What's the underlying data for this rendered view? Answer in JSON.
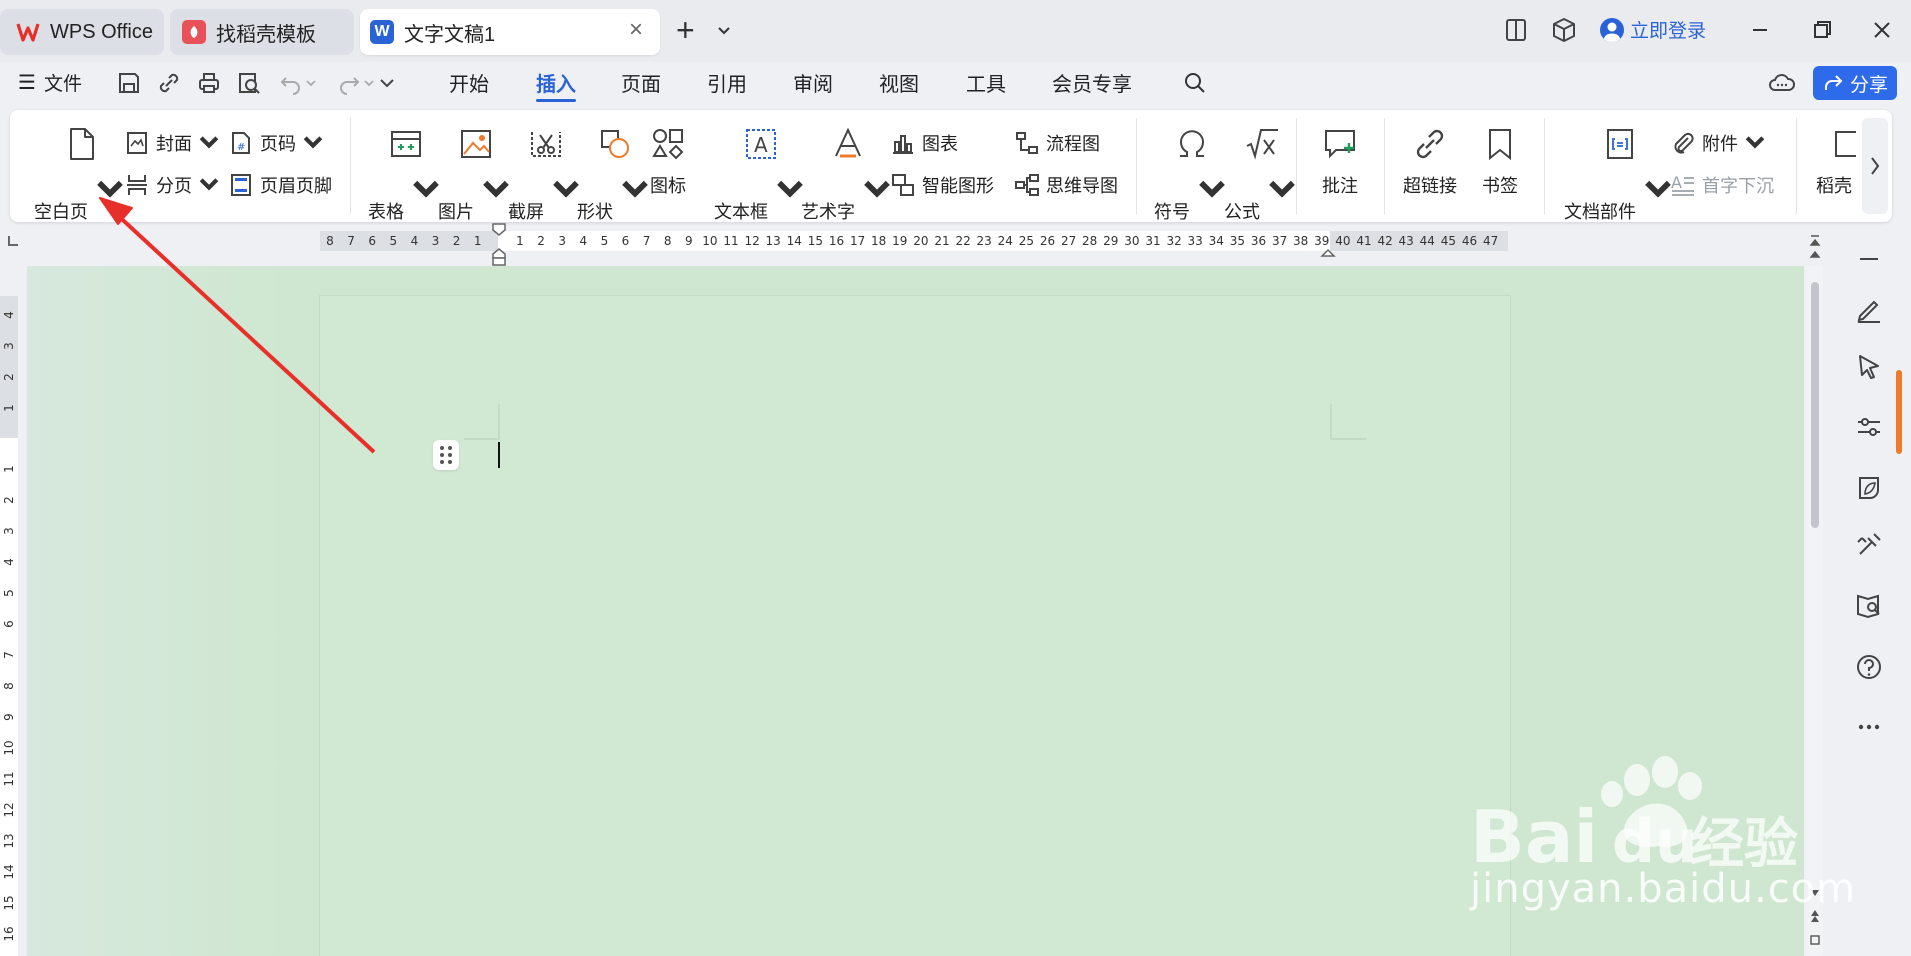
{
  "titlebar": {
    "tabs": [
      {
        "label": "WPS Office"
      },
      {
        "label": "找稻壳模板"
      },
      {
        "label": "文字文稿1"
      }
    ],
    "login_label": "立即登录"
  },
  "menubar": {
    "file_label": "文件",
    "tabs": [
      "开始",
      "插入",
      "页面",
      "引用",
      "审阅",
      "视图",
      "工具",
      "会员专享"
    ],
    "active_tab": "插入",
    "share_label": "分享"
  },
  "ribbon": {
    "blank_page": "空白页",
    "cover": "封面",
    "page_number": "页码",
    "page_break": "分页",
    "header_footer": "页眉页脚",
    "table": "表格",
    "picture": "图片",
    "screenshot": "截屏",
    "shape": "形状",
    "icon": "图标",
    "textbox": "文本框",
    "wordart": "艺术字",
    "chart": "图表",
    "smartart": "智能图形",
    "flowchart": "流程图",
    "mindmap": "思维导图",
    "symbol": "符号",
    "formula": "公式",
    "comment": "批注",
    "hyperlink": "超链接",
    "bookmark": "书签",
    "doc_parts": "文档部件",
    "attachment": "附件",
    "drop_cap": "首字下沉",
    "docer": "稻壳"
  },
  "ruler": {
    "left_numbers": [
      "8",
      "7",
      "6",
      "5",
      "4",
      "3",
      "2",
      "1"
    ],
    "right_numbers": [
      "1",
      "2",
      "3",
      "4",
      "5",
      "6",
      "7",
      "8",
      "9",
      "10",
      "11",
      "12",
      "13",
      "14",
      "15",
      "16",
      "17",
      "18",
      "19",
      "20",
      "21",
      "22",
      "23",
      "24",
      "25",
      "26",
      "27",
      "28",
      "29",
      "30",
      "31",
      "32",
      "33",
      "34",
      "35",
      "36",
      "37",
      "38",
      "39",
      "40",
      "41",
      "42",
      "43",
      "44",
      "45",
      "46",
      "47"
    ],
    "v_top_numbers": [
      "4",
      "3",
      "2",
      "1"
    ],
    "v_numbers": [
      "1",
      "2",
      "3",
      "4",
      "5",
      "6",
      "7",
      "8",
      "9",
      "10",
      "11",
      "12",
      "13",
      "14",
      "15",
      "16"
    ]
  },
  "watermark": {
    "brand": "Bai",
    "brand2": "du",
    "cn": "经验",
    "url": "jingyan.baidu.com"
  },
  "colors": {
    "accent": "#2a63d6",
    "doc_bg": "#cfe7d0",
    "arrow": "#e8302a"
  }
}
